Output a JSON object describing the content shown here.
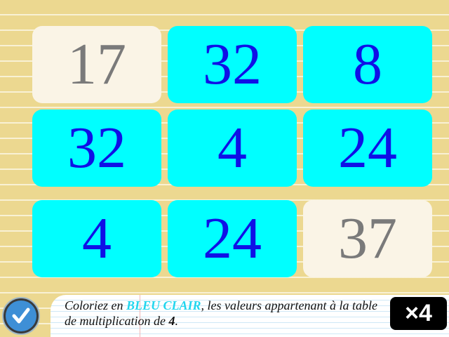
{
  "grid": {
    "tiles": [
      {
        "value": "17",
        "state": "blank"
      },
      {
        "value": "32",
        "state": "blue"
      },
      {
        "value": "8",
        "state": "blue"
      },
      {
        "value": "32",
        "state": "blue"
      },
      {
        "value": "4",
        "state": "blue"
      },
      {
        "value": "24",
        "state": "blue"
      },
      {
        "value": "4",
        "state": "blue"
      },
      {
        "value": "24",
        "state": "blue"
      },
      {
        "value": "37",
        "state": "blank"
      }
    ]
  },
  "instruction": {
    "part1": "Coloriez en ",
    "color_name": "BLEU CLAIR",
    "part2": ", les valeurs appartenant à la table de multiplication de ",
    "number": "4",
    "part3": "."
  },
  "badge": {
    "label": "×4"
  },
  "check_button": {
    "icon": "checkmark-icon"
  },
  "colors": {
    "blue_tile": "#00ffff",
    "blue_text": "#1010e6",
    "blank_tile": "#faf4e6",
    "blank_text": "#7a7a7a",
    "background": "#ecd890",
    "highlight": "#22d6ee"
  }
}
